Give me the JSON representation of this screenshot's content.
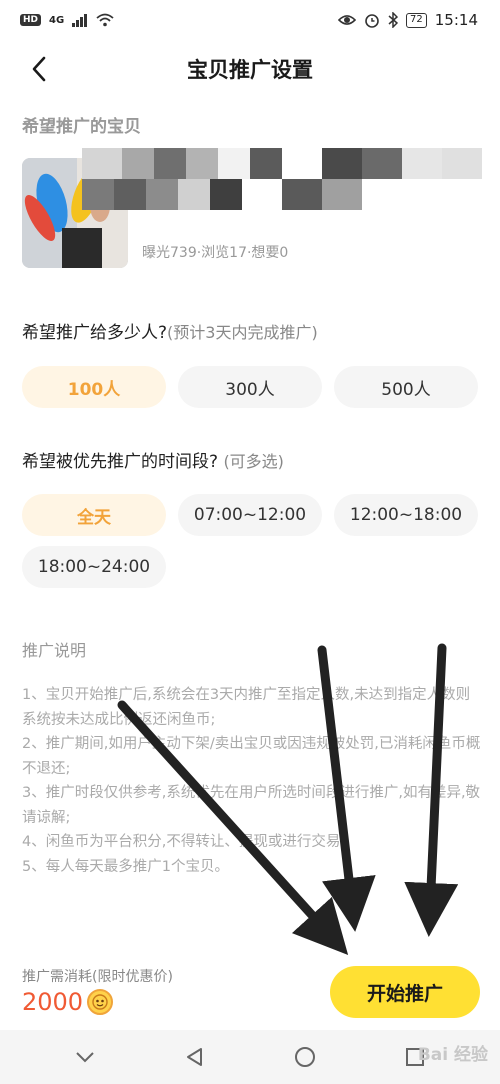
{
  "status_bar": {
    "hd": "HD",
    "signal": "4G",
    "battery": "72",
    "time": "15:14"
  },
  "header": {
    "title": "宝贝推广设置"
  },
  "product_section": {
    "label": "希望推广的宝贝",
    "stats": "曝光739·浏览17·想要0"
  },
  "audience": {
    "question": "希望推广给多少人?",
    "hint": "(预计3天内完成推广)",
    "options": [
      "100人",
      "300人",
      "500人"
    ],
    "selected": "100人"
  },
  "time_slots": {
    "question": "希望被优先推广的时间段?",
    "hint": "(可多选)",
    "options": [
      "全天",
      "07:00~12:00",
      "12:00~18:00",
      "18:00~24:00"
    ],
    "selected": "全天"
  },
  "notes": {
    "title": "推广说明",
    "items": [
      "1、宝贝开始推广后,系统会在3天内推广至指定人数,未达到指定人数则系统按未达成比例返还闲鱼币;",
      "2、推广期间,如用户主动下架/卖出宝贝或因违规被处罚,已消耗闲鱼币概不退还;",
      "3、推广时段仅供参考,系统优先在用户所选时间段进行推广,如有差异,敬请谅解;",
      "4、闲鱼币为平台积分,不得转让、提现或进行交易;",
      "5、每人每天最多推广1个宝贝。"
    ]
  },
  "footer": {
    "cost_label": "推广需消耗(限时优惠价)",
    "cost_value": "2000",
    "start_button": "开始推广"
  },
  "nav_icons": [
    "chevron-down-icon",
    "back-triangle-icon",
    "home-circle-icon",
    "recents-square-icon"
  ],
  "watermark": "Bai 经验",
  "colors": {
    "accent_yellow": "#ffe033",
    "selected_text": "#f2a33a",
    "selected_bg": "#fff5e4",
    "cost_red": "#f05a34"
  }
}
